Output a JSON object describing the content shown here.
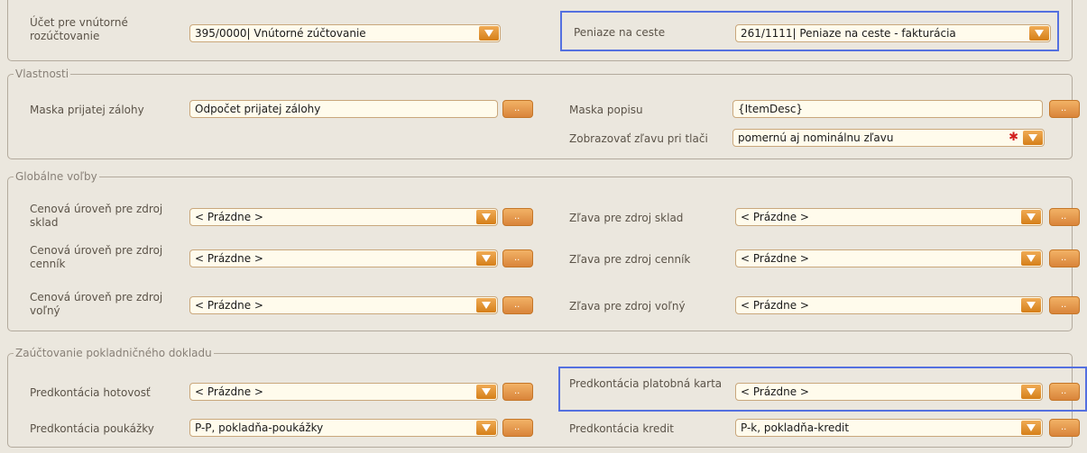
{
  "top": {
    "ucet_label": "Účet pre vnútorné rozúčtovanie",
    "ucet_value": "395/0000| Vnútorné zúčtovanie",
    "peniaze_label": "Peniaze na ceste",
    "peniaze_value": "261/1111| Peniaze na ceste - fakturácia"
  },
  "vlastnosti": {
    "legend": "Vlastnosti",
    "maska_zalohy_label": "Maska prijatej zálohy",
    "maska_zalohy_value": "Odpočet prijatej zálohy",
    "maska_popisu_label": "Maska popisu",
    "maska_popisu_value": "{ItemDesc}",
    "zlava_tlac_label": "Zobrazovať zľavu pri tlači",
    "zlava_tlac_value": "pomernú aj nominálnu zľavu"
  },
  "globalne": {
    "legend": "Globálne voľby",
    "cena_sklad_label": "Cenová úroveň pre zdroj sklad",
    "cena_cennik_label": "Cenová úroveň pre zdroj cenník",
    "cena_volny_label": "Cenová úroveň pre zdroj voľný",
    "zlava_sklad_label": "Zľava pre zdroj sklad",
    "zlava_cennik_label": "Zľava pre zdroj cenník",
    "zlava_volny_label": "Zľava pre zdroj voľný",
    "empty": "< Prázdne >"
  },
  "zauctovanie": {
    "legend": "Zaúčtovanie pokladničného dokladu",
    "hotovost_label": "Predkontácia hotovosť",
    "hotovost_value": "< Prázdne >",
    "karta_label": "Predkontácia platobná karta",
    "karta_value": "< Prázdne >",
    "poukazky_label": "Predkontácia poukážky",
    "poukazky_value": "P-P, pokladňa-poukážky",
    "kredit_label": "Predkontácia kredit",
    "kredit_value": "P-k, pokladňa-kredit"
  },
  "icons": {
    "dropdown": "chevron-down-icon",
    "browse": "ellipsis-icon",
    "required": "asterisk-icon"
  },
  "colors": {
    "accent": "#e08a2a",
    "highlight": "#5470e0",
    "background": "#ebe7de"
  }
}
